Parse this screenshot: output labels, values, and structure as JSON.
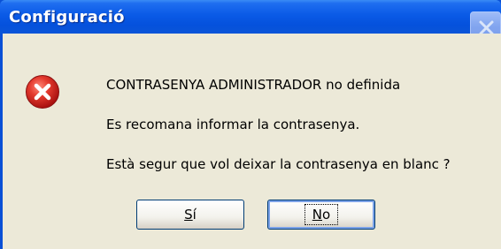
{
  "window": {
    "title": "Configuració",
    "close_icon": "close-icon"
  },
  "icon": "error-icon",
  "messages": {
    "line1": "CONTRASENYA ADMINISTRADOR no definida",
    "line2": "Es recomana informar la contrasenya.",
    "line3": "Està segur que vol deixar la contrasenya en blanc ?"
  },
  "buttons": {
    "yes": {
      "label": "Sí",
      "mnemonic": "S",
      "rest": "í"
    },
    "no": {
      "label": "No",
      "mnemonic": "N",
      "rest": "o"
    }
  },
  "colors": {
    "titlebar": "#0a5ae6",
    "client": "#ece9d8",
    "error_red": "#d8222b"
  }
}
